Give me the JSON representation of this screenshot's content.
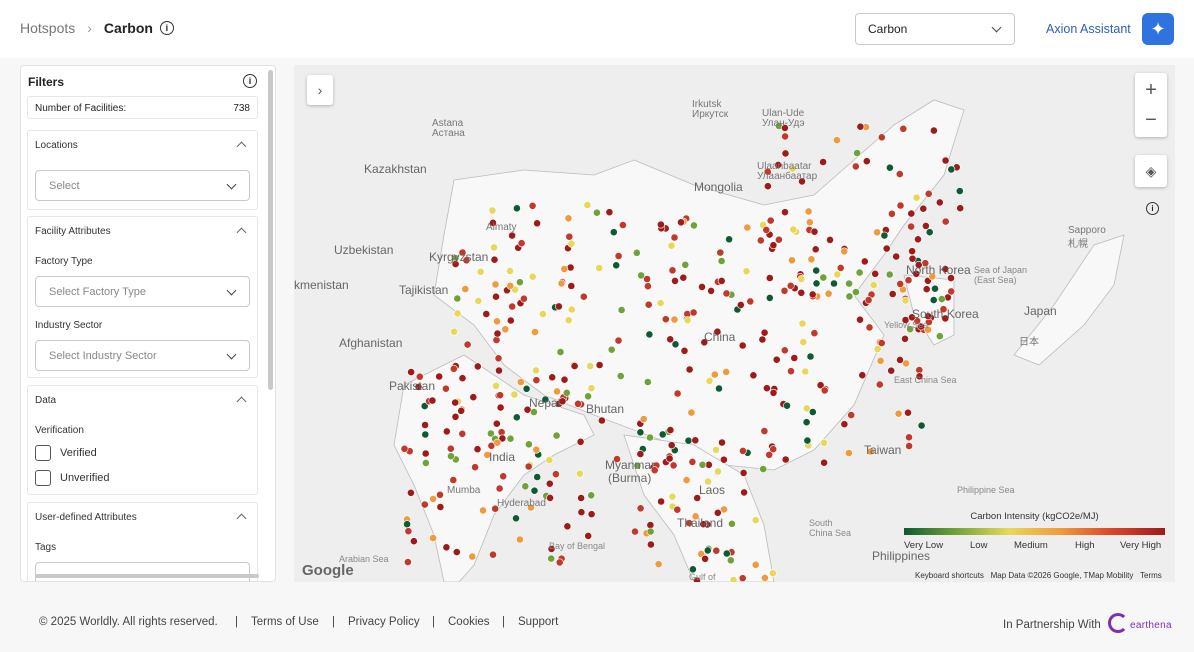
{
  "breadcrumb": {
    "root": "Hotspots",
    "current": "Carbon"
  },
  "metric_select": {
    "value": "Carbon"
  },
  "assistant": {
    "label": "Axion Assistant"
  },
  "filters": {
    "title": "Filters",
    "count_label": "Number of Facilities:",
    "count_value": "738",
    "locations": {
      "header": "Locations",
      "placeholder": "Select"
    },
    "facility_attributes": {
      "header": "Facility Attributes",
      "factory_type_label": "Factory Type",
      "factory_type_placeholder": "Select Factory Type",
      "industry_sector_label": "Industry Sector",
      "industry_sector_placeholder": "Select Industry Sector"
    },
    "data": {
      "header": "Data",
      "verification_label": "Verification",
      "verified": "Verified",
      "unverified": "Unverified"
    },
    "user_defined": {
      "header": "User-defined Attributes",
      "tags_label": "Tags"
    }
  },
  "map": {
    "labels": [
      {
        "text": "Mongolia",
        "cls": "big"
      },
      {
        "text": "China",
        "cls": "big"
      },
      {
        "text": "Kazakhstan",
        "cls": "big"
      },
      {
        "text": "Uzbekistan",
        "cls": "big"
      },
      {
        "text": "Kyrgyzstan",
        "cls": "big"
      },
      {
        "text": "Tajikistan",
        "cls": "big"
      },
      {
        "text": "kmenistan",
        "cls": "big"
      },
      {
        "text": "Afghanistan",
        "cls": "big"
      },
      {
        "text": "Pakistan",
        "cls": "big"
      },
      {
        "text": "India",
        "cls": "big"
      },
      {
        "text": "Nepal",
        "cls": "big"
      },
      {
        "text": "Bhutan",
        "cls": "big"
      },
      {
        "text": "Myanmar",
        "cls": "big"
      },
      {
        "text": "(Burma)",
        "cls": "big"
      },
      {
        "text": "Laos",
        "cls": "big"
      },
      {
        "text": "Thailand",
        "cls": "big"
      },
      {
        "text": "Taiwan",
        "cls": "big"
      },
      {
        "text": "Japan",
        "cls": "big"
      },
      {
        "text": "North Korea",
        "cls": "big"
      },
      {
        "text": "South Korea",
        "cls": "big"
      },
      {
        "text": "Philippines",
        "cls": "big"
      },
      {
        "text": "Astana",
        "cls": ""
      },
      {
        "text": "Астана",
        "cls": ""
      },
      {
        "text": "Irkutsk",
        "cls": ""
      },
      {
        "text": "Иркутск",
        "cls": ""
      },
      {
        "text": "Ulan-Ude",
        "cls": ""
      },
      {
        "text": "Улан-Удэ",
        "cls": ""
      },
      {
        "text": "Ulaanbaatar",
        "cls": ""
      },
      {
        "text": "Улаанбаатар",
        "cls": ""
      },
      {
        "text": "Sapporo",
        "cls": ""
      },
      {
        "text": "札幌",
        "cls": ""
      },
      {
        "text": "Sea of Japan",
        "cls": "s"
      },
      {
        "text": "(East Sea)",
        "cls": "s"
      },
      {
        "text": "Yellow Sea",
        "cls": "s"
      },
      {
        "text": "East China Sea",
        "cls": "s"
      },
      {
        "text": "Philippine Sea",
        "cls": "s"
      },
      {
        "text": "South",
        "cls": "s"
      },
      {
        "text": "China Sea",
        "cls": "s"
      },
      {
        "text": "Bay of Bengal",
        "cls": "s"
      },
      {
        "text": "Arabian Sea",
        "cls": "s"
      },
      {
        "text": "Hyderabad",
        "cls": ""
      },
      {
        "text": "Mumba",
        "cls": ""
      },
      {
        "text": "Almaty",
        "cls": ""
      },
      {
        "text": "日本",
        "cls": ""
      },
      {
        "text": "Gulf of",
        "cls": "s"
      }
    ],
    "google": "Google",
    "attribution": {
      "shortcuts": "Keyboard shortcuts",
      "data": "Map Data ©2026 Google, TMap Mobility",
      "terms": "Terms"
    },
    "legend": {
      "title": "Carbon Intensity (kgCO2e/MJ)",
      "ticks": [
        "Very Low",
        "Low",
        "Medium",
        "High",
        "Very High"
      ]
    },
    "colors": {
      "very_low": "#0f5a32",
      "low": "#6fa33a",
      "medium": "#e8d85a",
      "high": "#ef9a3e",
      "very_high": "#9e1b1b",
      "red": "#c0392b"
    }
  },
  "footer": {
    "copyright": "© 2025 Worldly. All rights reserved.",
    "terms": "Terms of Use",
    "privacy": "Privacy Policy",
    "cookies": "Cookies",
    "support": "Support",
    "sep": "|",
    "partnership": "In Partnership With",
    "partner_name": "earthena"
  }
}
